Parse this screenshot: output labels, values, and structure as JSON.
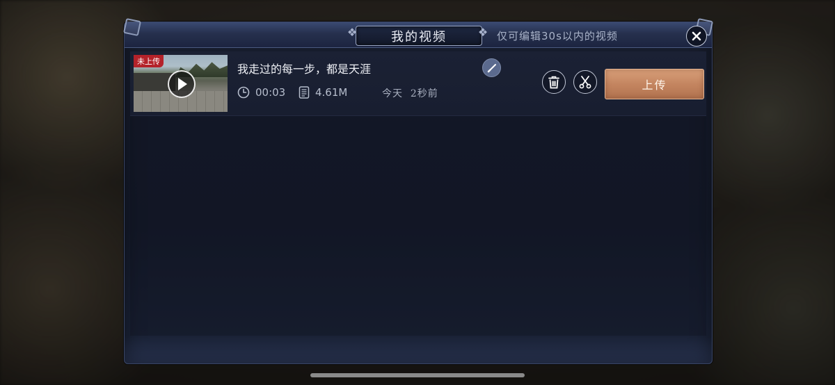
{
  "header": {
    "title": "我的视频",
    "subtitle": "仅可编辑30s以内的视频"
  },
  "videos": [
    {
      "status_badge": "未上传",
      "title": "我走过的每一步，都是天涯",
      "duration": "00:03",
      "size": "4.61M",
      "time": "今天  2秒前",
      "upload_label": "上传"
    }
  ],
  "icons": {
    "close": "close-icon",
    "play": "play-icon",
    "edit": "brush-icon",
    "clock": "clock-icon",
    "file": "file-icon",
    "delete": "trash-icon",
    "trim": "scissors-icon"
  },
  "colors": {
    "panel_bg": "#171c2c",
    "upload_button": "#c48560",
    "badge": "#b4222a"
  }
}
